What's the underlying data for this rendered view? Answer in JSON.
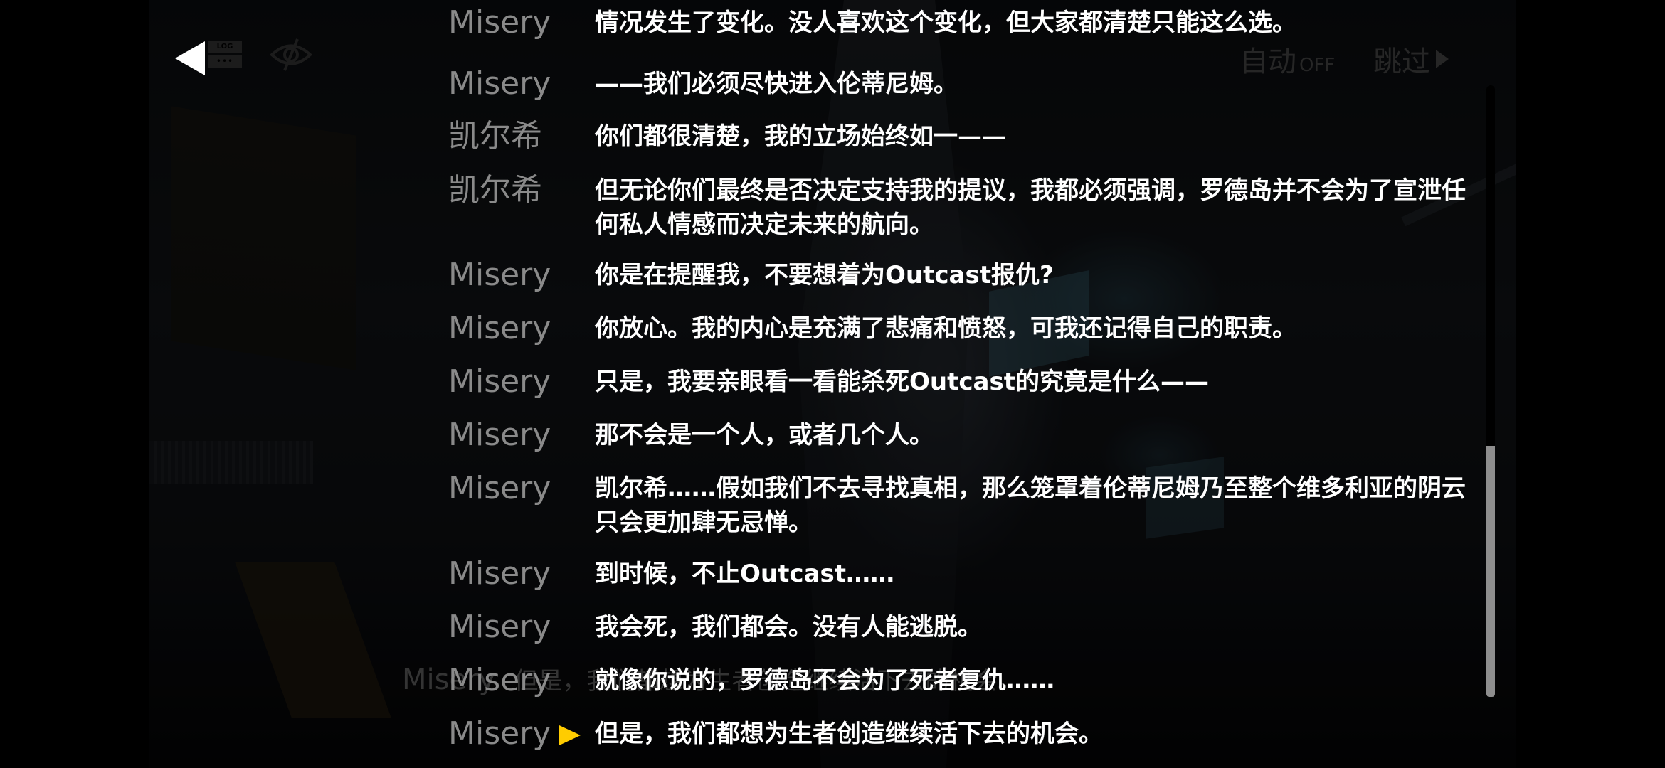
{
  "toolbar": {
    "back_icon": "back-triangle-icon",
    "log_icon_label": "LOG",
    "log_icon_dots": "•••",
    "hide_ui_icon": "eye-slash-icon",
    "auto_label": "自动",
    "auto_state": "OFF",
    "skip_label": "跳过"
  },
  "underlying_dialogue": {
    "speaker": "Misery",
    "text": "但是，我们都想为生者创造继续活下去的机会。"
  },
  "log": {
    "entries": [
      {
        "speaker": "Misery",
        "text": "情况发生了变化。没人喜欢这个变化，但大家都清楚只能这么选。",
        "current": false
      },
      {
        "speaker": "Misery",
        "text": "——我们必须尽快进入伦蒂尼姆。",
        "current": false
      },
      {
        "speaker": "凯尔希",
        "text": "你们都很清楚，我的立场始终如一——",
        "current": false
      },
      {
        "speaker": "凯尔希",
        "text": "但无论你们最终是否决定支持我的提议，我都必须强调，罗德岛并不会为了宣泄任何私人情感而决定未来的航向。",
        "current": false
      },
      {
        "speaker": "Misery",
        "text": "你是在提醒我，不要想着为Outcast报仇?",
        "current": false
      },
      {
        "speaker": "Misery",
        "text": "你放心。我的内心是充满了悲痛和愤怒，可我还记得自己的职责。",
        "current": false
      },
      {
        "speaker": "Misery",
        "text": "只是，我要亲眼看一看能杀死Outcast的究竟是什么——",
        "current": false
      },
      {
        "speaker": "Misery",
        "text": "那不会是一个人，或者几个人。",
        "current": false
      },
      {
        "speaker": "Misery",
        "text": "凯尔希……假如我们不去寻找真相，那么笼罩着伦蒂尼姆乃至整个维多利亚的阴云只会更加肆无忌惮。",
        "current": false
      },
      {
        "speaker": "Misery",
        "text": "到时候，不止Outcast……",
        "current": false
      },
      {
        "speaker": "Misery",
        "text": "我会死，我们都会。没有人能逃脱。",
        "current": false
      },
      {
        "speaker": "Misery",
        "text": "就像你说的，罗德岛不会为了死者复仇……",
        "current": false
      },
      {
        "speaker": "Misery",
        "text": "但是，我们都想为生者创造继续活下去的机会。",
        "current": true
      }
    ]
  },
  "scrollbar": {
    "thumb_fraction": 0.41,
    "position": "bottom"
  },
  "colors": {
    "speaker": "#8a8a8a",
    "text": "#ffffff",
    "current_marker": "#ffcc00",
    "scroll_thumb": "#8e8e8e",
    "inactive_controls": "#262626"
  }
}
